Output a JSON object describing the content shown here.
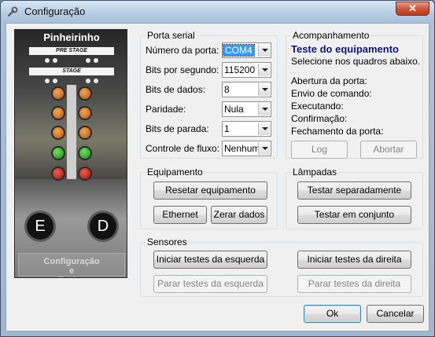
{
  "window": {
    "title": "Configuração",
    "close_label": "✕"
  },
  "promo": {
    "brand": "Pinheirinho",
    "pre_stage": "PRE STAGE",
    "stage": "STAGE",
    "left_button": "E",
    "right_button": "D",
    "config_text": "Configuração\ne\nTestes"
  },
  "serial": {
    "legend": "Porta serial",
    "port_label": "Número da porta:",
    "port_value": "COM4",
    "baud_label": "Bits por segundo:",
    "baud_value": "115200",
    "databits_label": "Bits de dados:",
    "databits_value": "8",
    "parity_label": "Paridade:",
    "parity_value": "Nula",
    "stopbits_label": "Bits de parada:",
    "stopbits_value": "1",
    "flow_label": "Controle de fluxo:",
    "flow_value": "Nenhum"
  },
  "monitor": {
    "legend": "Acompanhamento",
    "heading": "Teste do equipamento",
    "hint": "Selecione nos quadros abaixo.",
    "open_port": "Abertura da porta:",
    "send_cmd": "Envio de comando:",
    "running": "Executando:",
    "confirm": "Confirmação:",
    "close_port": "Fechamento da porta:",
    "log_button": "Log",
    "abort_button": "Abortar"
  },
  "equipment": {
    "legend": "Equipamento",
    "reset_button": "Resetar equipamento",
    "ethernet_button": "Ethernet",
    "clear_button": "Zerar dados"
  },
  "lamps": {
    "legend": "Lâmpadas",
    "separate_button": "Testar separadamente",
    "together_button": "Testar em conjunto"
  },
  "sensors": {
    "legend": "Sensores",
    "start_left": "Iniciar testes da esquerda",
    "start_right": "Iniciar testes da direita",
    "stop_left": "Parar testes da esquerda",
    "stop_right": "Parar testes da direita"
  },
  "footer": {
    "ok_button": "Ok",
    "cancel_button": "Cancelar"
  }
}
